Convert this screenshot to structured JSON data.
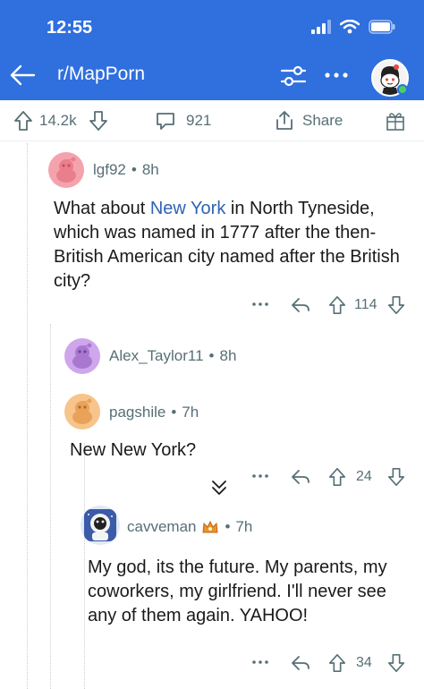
{
  "status": {
    "time": "12:55"
  },
  "header": {
    "subreddit": "r/MapPorn",
    "bg_color": "#2f6fde"
  },
  "post_bar": {
    "upvotes": "14.2k",
    "comments": "921",
    "share_label": "Share"
  },
  "comments": [
    {
      "username": "lgf92",
      "age": "8h",
      "body_parts": [
        "What about ",
        "New York",
        " in North Tyneside, which was named in 1777 after the then-British American city named after the British city?"
      ],
      "votes": "114"
    },
    {
      "username": "Alex_Taylor11",
      "age": "8h"
    },
    {
      "username": "pagshile",
      "age": "7h",
      "body": "New New York?",
      "votes": "24"
    },
    {
      "username": "cavveman",
      "age": "7h",
      "body": "My god, its the future. My parents, my coworkers, my girlfriend. I'll never see any of them again. YAHOO!",
      "votes": "34"
    }
  ],
  "separator": "•",
  "colors": {
    "accent": "#2f6fde",
    "link": "#2f63b4",
    "meta": "#576f76"
  }
}
